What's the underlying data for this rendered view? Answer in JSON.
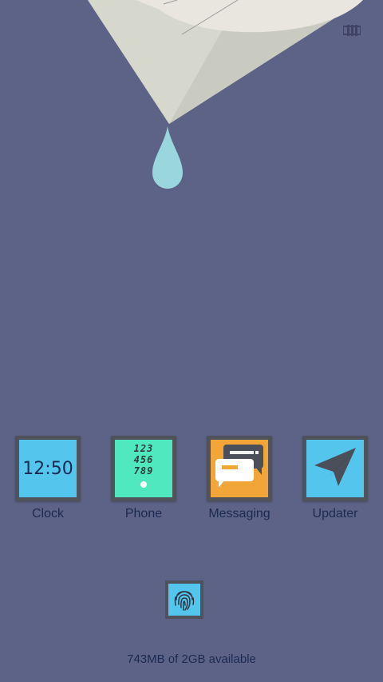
{
  "wallpaper": {
    "name": "drip-wallpaper"
  },
  "apps": [
    {
      "label": "Clock",
      "icon": "clock-icon",
      "face_text": "12:50"
    },
    {
      "label": "Phone",
      "icon": "phone-dialpad-icon",
      "digits": [
        "123",
        "456",
        "789"
      ]
    },
    {
      "label": "Messaging",
      "icon": "messaging-icon"
    },
    {
      "label": "Updater",
      "icon": "paper-plane-icon"
    }
  ],
  "fingerprint": {
    "icon": "fingerprint-icon"
  },
  "storage": {
    "text": "743MB of 2GB available"
  },
  "colors": {
    "background": "#5d6386",
    "tile_frame": "#4f525b",
    "cyan": "#54c6ee",
    "mint": "#4fe8bf",
    "orange": "#f2a638",
    "text": "#1b2a52"
  }
}
